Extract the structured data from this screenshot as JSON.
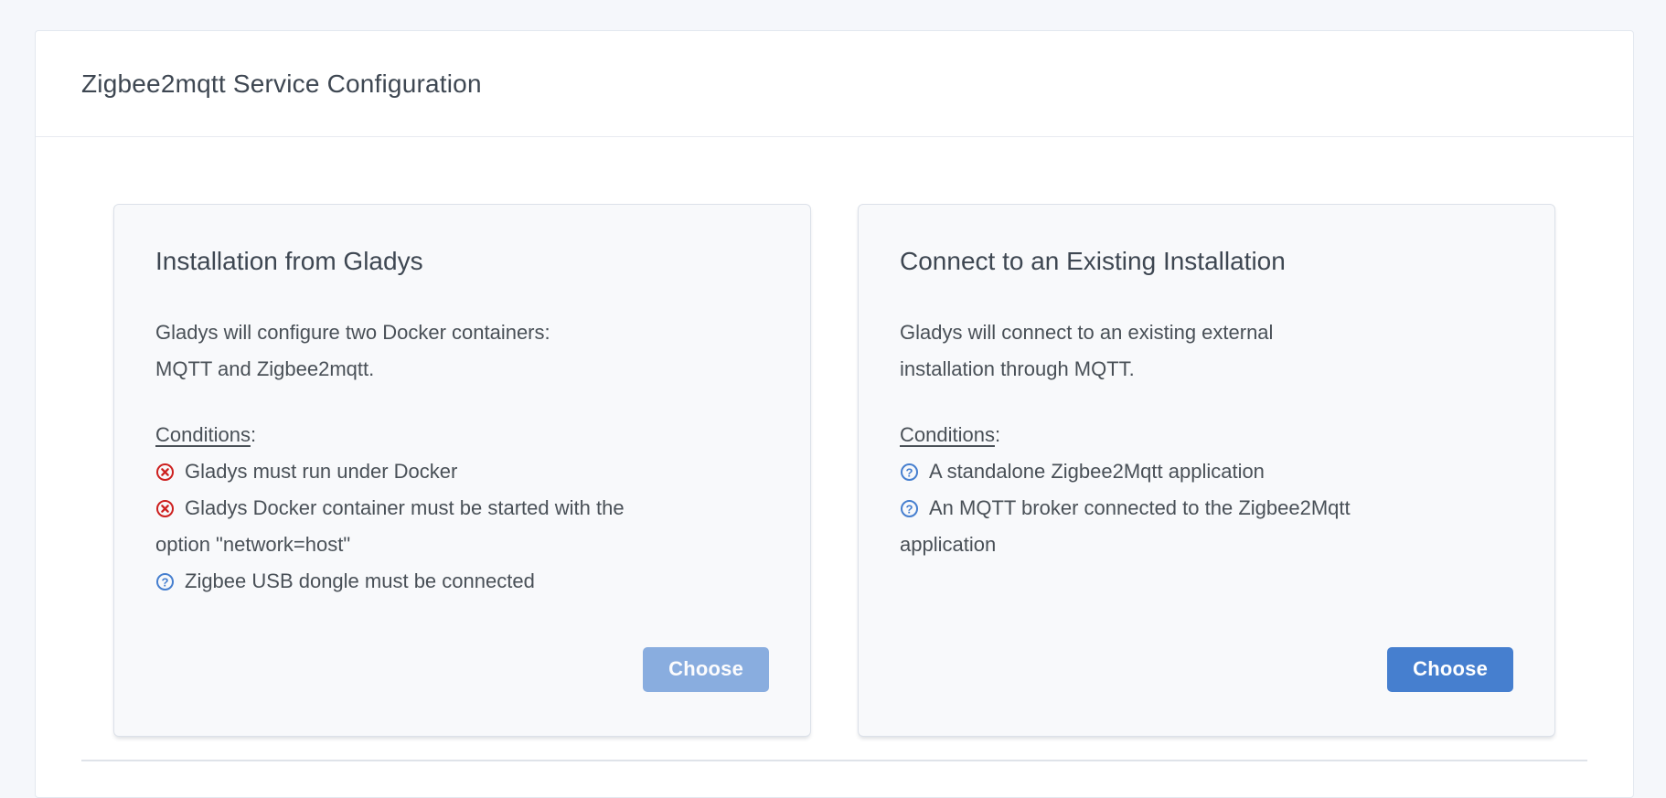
{
  "page": {
    "title": "Zigbee2mqtt Service Configuration"
  },
  "colors": {
    "accent": "#467fcf",
    "danger": "#cd201f",
    "card_background": "#f8f9fb",
    "page_background": "#f5f7fb"
  },
  "cards": [
    {
      "title": "Installation from Gladys",
      "description": "Gladys will configure two Docker containers: MQTT and Zigbee2mqtt.",
      "conditions_label": "Conditions",
      "conditions_suffix": ":",
      "conditions": [
        {
          "icon": "times-circle",
          "status": "not-met",
          "text": "Gladys must run under Docker"
        },
        {
          "icon": "times-circle",
          "status": "not-met",
          "text": "Gladys Docker container must be started with the option \"network=host\""
        },
        {
          "icon": "question-circle",
          "status": "unknown",
          "text": "Zigbee USB dongle must be connected"
        }
      ],
      "button": {
        "label": "Choose",
        "enabled": false
      }
    },
    {
      "title": "Connect to an Existing Installation",
      "description": "Gladys will connect to an existing external installation through MQTT.",
      "conditions_label": "Conditions",
      "conditions_suffix": ":",
      "conditions": [
        {
          "icon": "question-circle",
          "status": "unknown",
          "text": "A standalone Zigbee2Mqtt application"
        },
        {
          "icon": "question-circle",
          "status": "unknown",
          "text": "An MQTT broker connected to the Zigbee2Mqtt application"
        }
      ],
      "button": {
        "label": "Choose",
        "enabled": true
      }
    }
  ]
}
